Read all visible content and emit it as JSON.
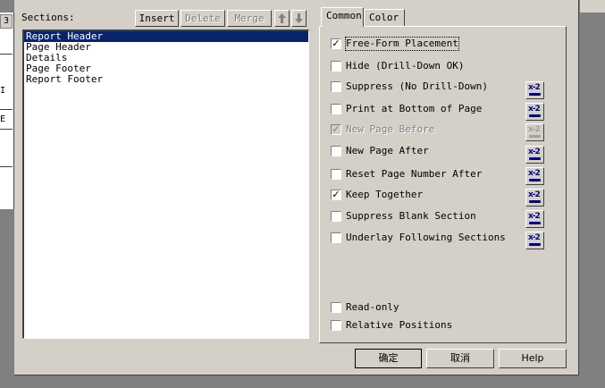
{
  "background": {
    "tab_number": "3",
    "letters": [
      "I",
      "E"
    ]
  },
  "sections": {
    "label": "Sections:",
    "toolbar": {
      "insert": "Insert",
      "delete": "Delete",
      "merge": "Merge"
    },
    "items": [
      {
        "label": "Report Header",
        "selected": true
      },
      {
        "label": "Page Header",
        "selected": false
      },
      {
        "label": "Details",
        "selected": false
      },
      {
        "label": "Page Footer",
        "selected": false
      },
      {
        "label": "Report Footer",
        "selected": false
      }
    ]
  },
  "tabs": [
    {
      "label": "Common",
      "active": true
    },
    {
      "label": "Color",
      "active": false
    }
  ],
  "options": [
    {
      "label": "Free-Form Placement",
      "checked": true,
      "disabled": false,
      "formula": false
    },
    {
      "label": "Hide (Drill-Down OK)",
      "checked": false,
      "disabled": false,
      "formula": false
    },
    {
      "label": "Suppress (No Drill-Down)",
      "checked": false,
      "disabled": false,
      "formula": true
    },
    {
      "label": "Print at Bottom of Page",
      "checked": false,
      "disabled": false,
      "formula": true
    },
    {
      "label": "New Page Before",
      "checked": true,
      "disabled": true,
      "formula": true
    },
    {
      "label": "New Page After",
      "checked": false,
      "disabled": false,
      "formula": true
    },
    {
      "label": "Reset Page Number After",
      "checked": false,
      "disabled": false,
      "formula": true
    },
    {
      "label": "Keep Together",
      "checked": true,
      "disabled": false,
      "formula": true
    },
    {
      "label": "Suppress Blank Section",
      "checked": false,
      "disabled": false,
      "formula": true
    },
    {
      "label": "Underlay Following Sections",
      "checked": false,
      "disabled": false,
      "formula": true
    }
  ],
  "bottom_options": [
    {
      "label": "Read-only",
      "checked": false
    },
    {
      "label": "Relative Positions",
      "checked": false
    }
  ],
  "formula_glyph": "x-2",
  "buttons": {
    "ok": "确定",
    "cancel": "取消",
    "help": "Help"
  },
  "colors": {
    "selection": "#0a246a",
    "face": "#d4d0c8",
    "formula_icon": "#000080"
  }
}
